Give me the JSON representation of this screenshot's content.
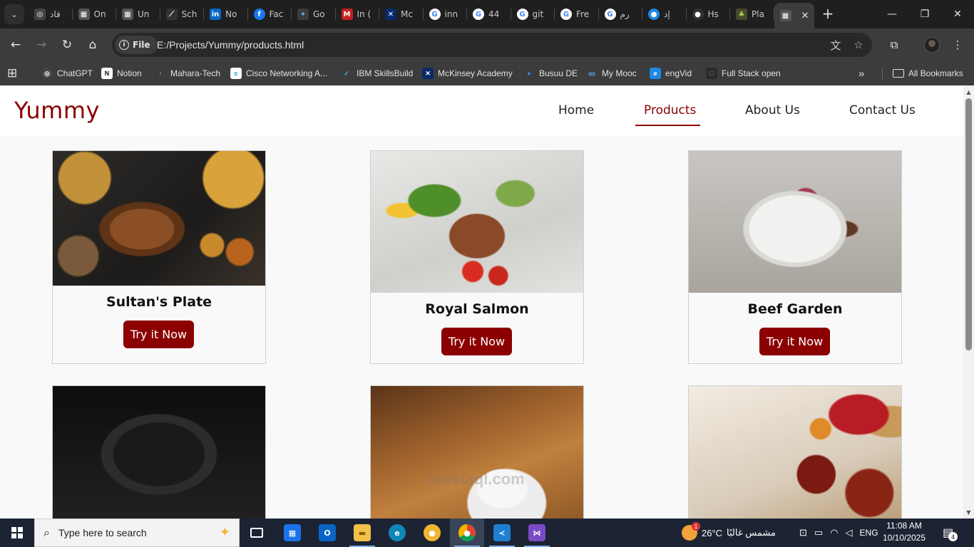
{
  "browser": {
    "tabs": [
      {
        "title": "قاد",
        "fav_text": "◎",
        "fav_color": "#444444"
      },
      {
        "title": "On",
        "fav_text": "▦",
        "fav_color": "#555555"
      },
      {
        "title": "Un",
        "fav_text": "▦",
        "fav_color": "#555555"
      },
      {
        "title": "Sch",
        "fav_text": "⟋",
        "fav_color": "#333333"
      },
      {
        "title": "No",
        "fav_text": "in",
        "fav_color": "#0a66c2"
      },
      {
        "title": "Fac",
        "fav_text": "f",
        "fav_color": "#1877f2"
      },
      {
        "title": "Go",
        "fav_text": "✦",
        "fav_color": "#3b3b3b"
      },
      {
        "title": "In (",
        "fav_text": "M",
        "fav_color": "#c5221f"
      },
      {
        "title": "Mc",
        "fav_text": "✕",
        "fav_color": "#0a2a6a"
      },
      {
        "title": "inn",
        "fav_text": "G",
        "fav_color": "#4285f4"
      },
      {
        "title": "44",
        "fav_text": "G",
        "fav_color": "#4285f4"
      },
      {
        "title": "git",
        "fav_text": "G",
        "fav_color": "#4285f4"
      },
      {
        "title": "Fre",
        "fav_text": "G",
        "fav_color": "#4285f4"
      },
      {
        "title": "رم",
        "fav_text": "G",
        "fav_color": "#4285f4"
      },
      {
        "title": "إد",
        "fav_text": "●",
        "fav_color": "#1e88e5"
      },
      {
        "title": "Hs",
        "fav_text": "●",
        "fav_color": "#333333"
      },
      {
        "title": "Pla",
        "fav_text": "♣",
        "fav_color": "#4a4a2a"
      }
    ],
    "active_tab": {
      "fav_text": "▦",
      "close": "✕"
    },
    "new_tab": "+",
    "window_controls": {
      "minimize": "—",
      "maximize": "❐",
      "close": "✕"
    },
    "toolbar": {
      "back": "←",
      "forward": "→",
      "reload": "↻",
      "home": "⌂",
      "site_info_label": "File",
      "url": "E:/Projects/Yummy/products.html",
      "translate_icon": "文",
      "bookmark_icon": "☆",
      "extensions_icon": "⧉",
      "menu_icon": "⋮"
    },
    "bookmarks": [
      {
        "label": "ChatGPT",
        "fav_text": "◎",
        "fav_color": "#444444"
      },
      {
        "label": "Notion",
        "fav_text": "N",
        "fav_color": "#2b2b2b"
      },
      {
        "label": "Mahara-Tech",
        "fav_text": "↑",
        "fav_color": "#7a5a2a"
      },
      {
        "label": "Cisco Networking A...",
        "fav_text": "c",
        "fav_color": "#6a6a6a"
      },
      {
        "label": "IBM SkillsBuild",
        "fav_text": "✓",
        "fav_color": "#0f62fe"
      },
      {
        "label": "McKinsey Academy",
        "fav_text": "✕",
        "fav_color": "#0a2a6a"
      },
      {
        "label": "Busuu DE",
        "fav_text": "●",
        "fav_color": "#3b82f6"
      },
      {
        "label": "My Mooc",
        "fav_text": "∞",
        "fav_color": "#1e63b8"
      },
      {
        "label": "engVid",
        "fav_text": "e",
        "fav_color": "#1e88e5"
      },
      {
        "label": "Full Stack open",
        "fav_text": "□",
        "fav_color": "#2b2b2b"
      }
    ],
    "bookmarks_overflow": "»",
    "all_bookmarks": "All Bookmarks",
    "apps_icon": "⊞"
  },
  "site": {
    "logo": "Yummy",
    "nav": [
      {
        "label": "Home"
      },
      {
        "label": "Products"
      },
      {
        "label": "About Us"
      },
      {
        "label": "Contact Us"
      }
    ],
    "active_nav": "Products",
    "products": [
      {
        "title": "Sultan's Plate",
        "button": "Try it Now"
      },
      {
        "title": "Royal Salmon",
        "button": "Try it Now"
      },
      {
        "title": "Beef Garden",
        "button": "Try it Now"
      }
    ],
    "watermark": "mostaql.com"
  },
  "taskbar": {
    "search_placeholder": "Type here to search",
    "weather_temp": "26°C",
    "weather_text": "مشمس غالبًا",
    "weather_badge": "1",
    "language": "ENG",
    "time": "11:08 AM",
    "date": "10/10/2025",
    "notification_count": "4"
  },
  "colors": {
    "brand": "#8b0000",
    "browser_dark": "#1f1f1f",
    "toolbar": "#3c3c3c",
    "taskbar": "#1c2433"
  }
}
